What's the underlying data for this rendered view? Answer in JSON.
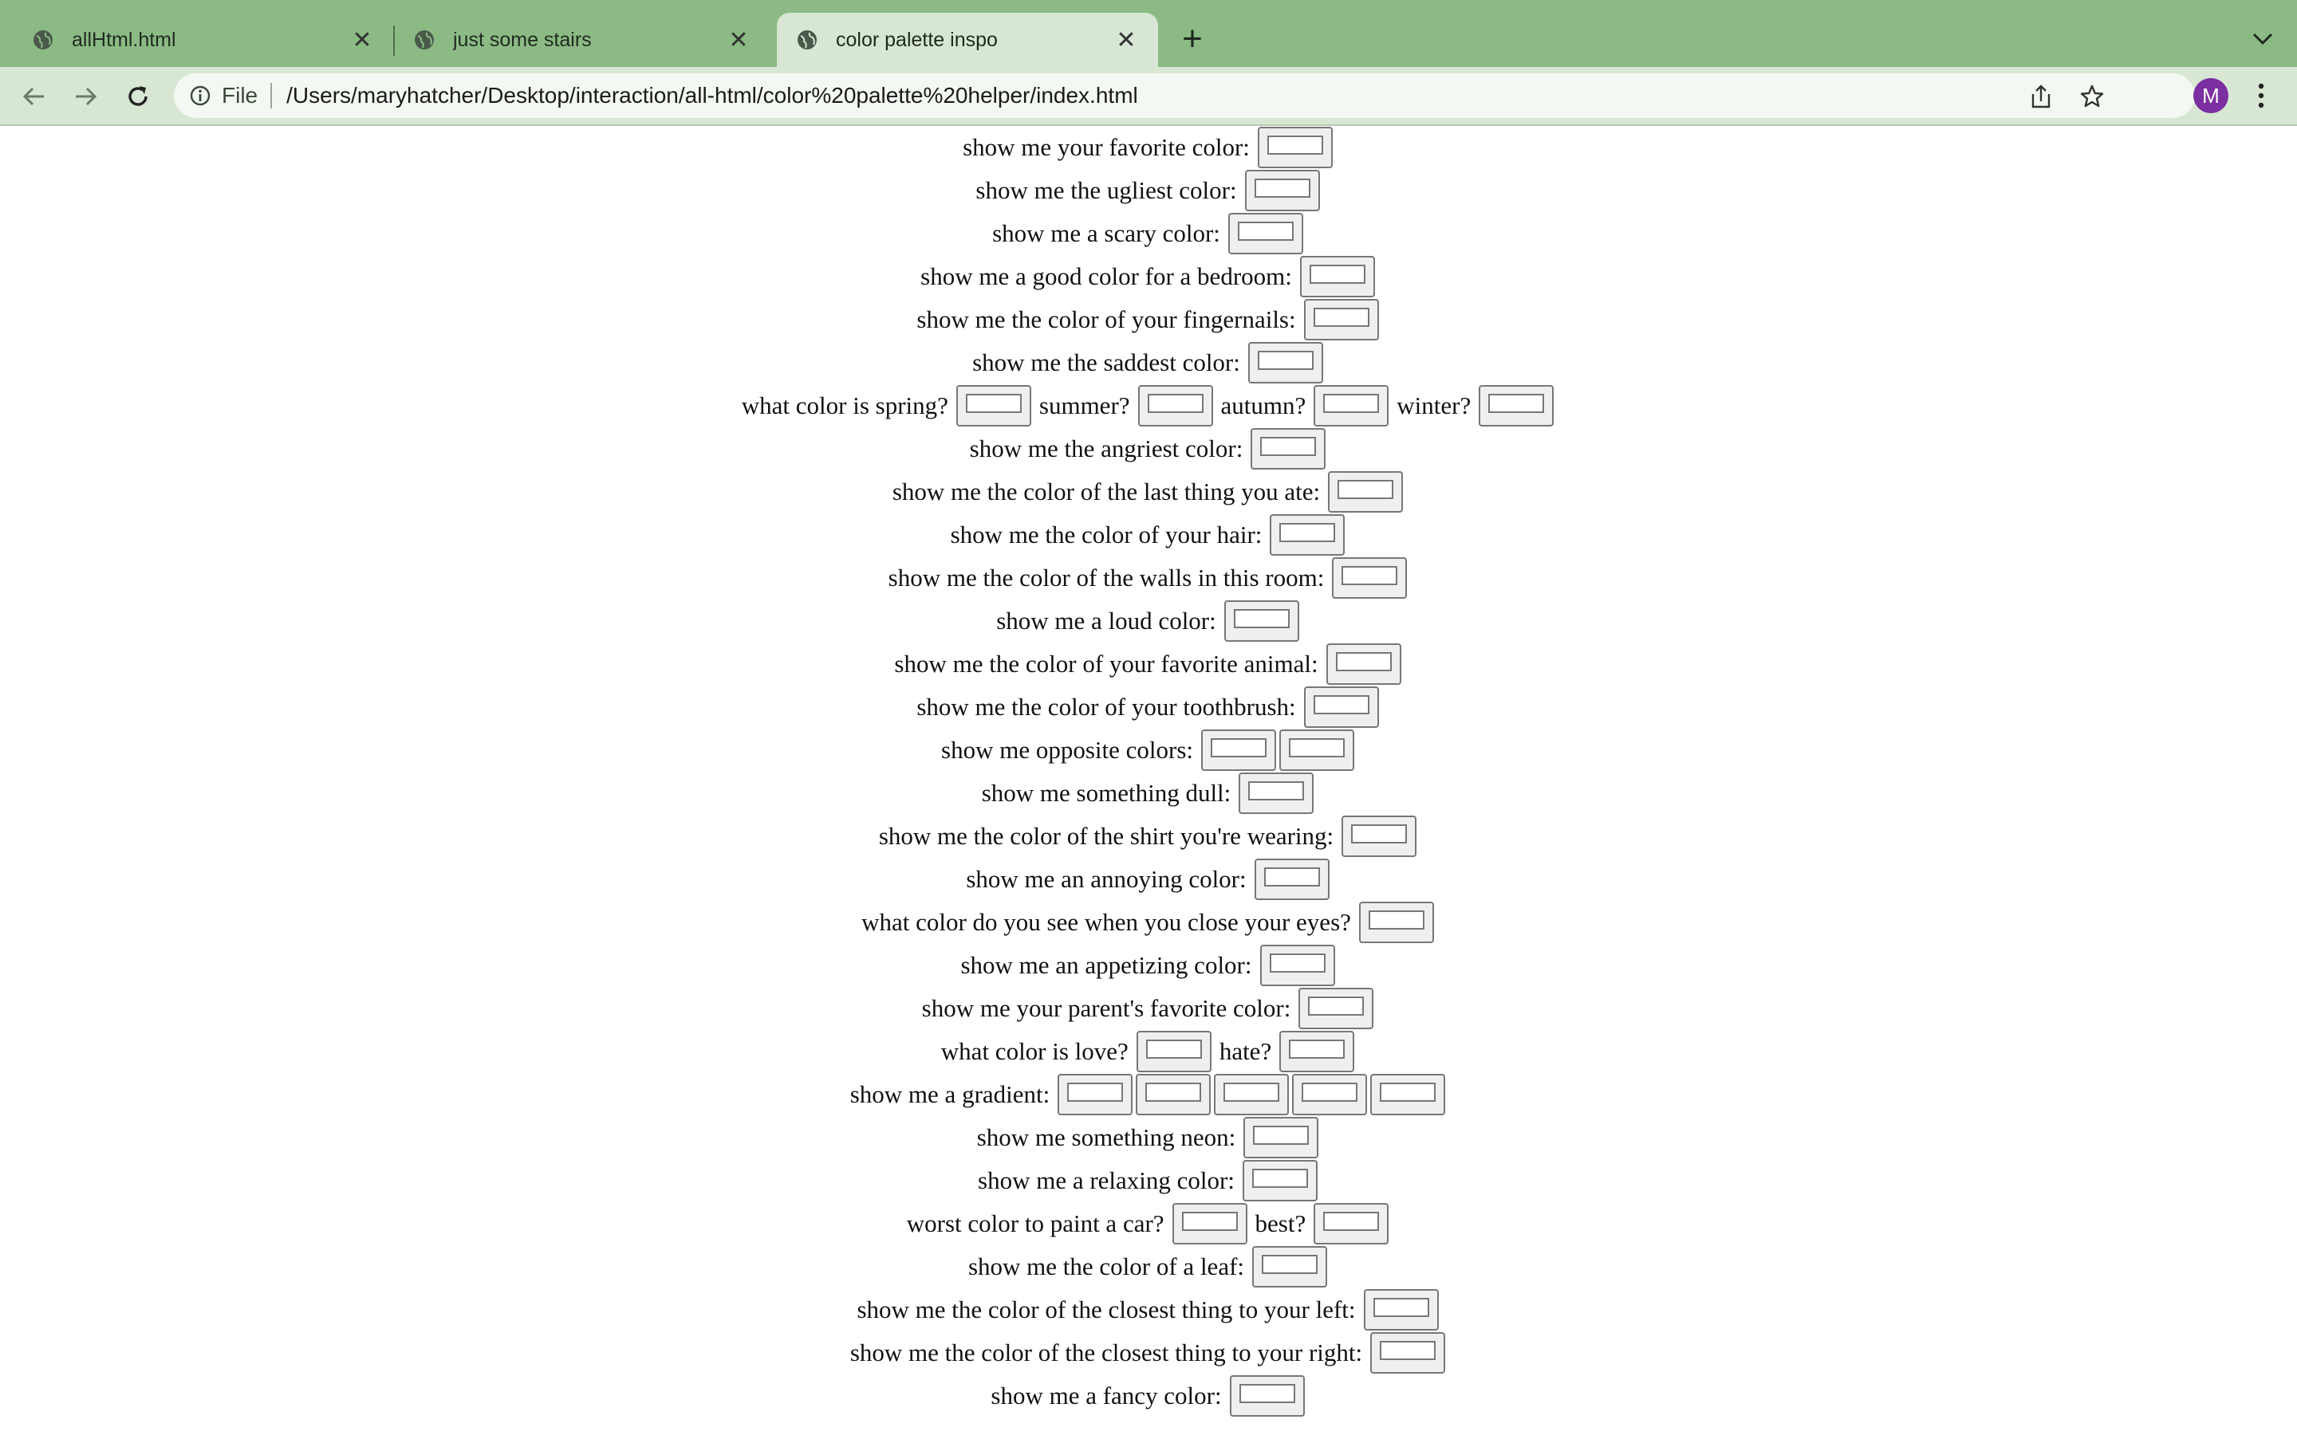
{
  "browser": {
    "tabs": [
      {
        "title": "allHtml.html",
        "active": false
      },
      {
        "title": "just some stairs",
        "active": false
      },
      {
        "title": "color palette inspo",
        "active": true
      }
    ],
    "address": {
      "scheme": "File",
      "url": "/Users/maryhatcher/Desktop/interaction/all-html/color%20palette%20helper/index.html"
    },
    "profile_initial": "M",
    "colors": {
      "tabbar": "#8cba85",
      "toolbar": "#d7e7d3",
      "avatar": "#7b2fa0"
    }
  },
  "page": {
    "rows": [
      {
        "parts": [
          {
            "label": "show me your favorite color:",
            "swatches": 1
          }
        ]
      },
      {
        "parts": [
          {
            "label": "show me the ugliest color:",
            "swatches": 1
          }
        ]
      },
      {
        "parts": [
          {
            "label": "show me a scary color:",
            "swatches": 1
          }
        ]
      },
      {
        "parts": [
          {
            "label": "show me a good color for a bedroom:",
            "swatches": 1
          }
        ]
      },
      {
        "parts": [
          {
            "label": "show me the color of your fingernails:",
            "swatches": 1
          }
        ]
      },
      {
        "parts": [
          {
            "label": "show me the saddest color:",
            "swatches": 1
          }
        ]
      },
      {
        "parts": [
          {
            "label": "what color is spring?",
            "swatches": 1
          },
          {
            "label": "summer?",
            "swatches": 1
          },
          {
            "label": "autumn?",
            "swatches": 1
          },
          {
            "label": "winter?",
            "swatches": 1
          }
        ]
      },
      {
        "parts": [
          {
            "label": "show me the angriest color:",
            "swatches": 1
          }
        ]
      },
      {
        "parts": [
          {
            "label": "show me the color of the last thing you ate:",
            "swatches": 1
          }
        ]
      },
      {
        "parts": [
          {
            "label": "show me the color of your hair:",
            "swatches": 1
          }
        ]
      },
      {
        "parts": [
          {
            "label": "show me the color of the walls in this room:",
            "swatches": 1
          }
        ]
      },
      {
        "parts": [
          {
            "label": "show me a loud color:",
            "swatches": 1
          }
        ]
      },
      {
        "parts": [
          {
            "label": "show me the color of your favorite animal:",
            "swatches": 1
          }
        ]
      },
      {
        "parts": [
          {
            "label": "show me the color of your toothbrush:",
            "swatches": 1
          }
        ]
      },
      {
        "parts": [
          {
            "label": "show me opposite colors:",
            "swatches": 2
          }
        ]
      },
      {
        "parts": [
          {
            "label": "show me something dull:",
            "swatches": 1
          }
        ]
      },
      {
        "parts": [
          {
            "label": "show me the color of the shirt you're wearing:",
            "swatches": 1
          }
        ]
      },
      {
        "parts": [
          {
            "label": "show me an annoying color:",
            "swatches": 1
          }
        ]
      },
      {
        "parts": [
          {
            "label": "what color do you see when you close your eyes?",
            "swatches": 1
          }
        ]
      },
      {
        "parts": [
          {
            "label": "show me an appetizing color:",
            "swatches": 1
          }
        ]
      },
      {
        "parts": [
          {
            "label": "show me your parent's favorite color:",
            "swatches": 1
          }
        ]
      },
      {
        "parts": [
          {
            "label": "what color is love?",
            "swatches": 1
          },
          {
            "label": "hate?",
            "swatches": 1
          }
        ]
      },
      {
        "parts": [
          {
            "label": "show me a gradient:",
            "swatches": 5
          }
        ]
      },
      {
        "parts": [
          {
            "label": "show me something neon:",
            "swatches": 1
          }
        ]
      },
      {
        "parts": [
          {
            "label": "show me a relaxing color:",
            "swatches": 1
          }
        ]
      },
      {
        "parts": [
          {
            "label": "worst color to paint a car?",
            "swatches": 1
          },
          {
            "label": "best?",
            "swatches": 1
          }
        ]
      },
      {
        "parts": [
          {
            "label": "show me the color of a leaf:",
            "swatches": 1
          }
        ]
      },
      {
        "parts": [
          {
            "label": "show me the color of the closest thing to your left:",
            "swatches": 1
          }
        ]
      },
      {
        "parts": [
          {
            "label": "show me the color of the closest thing to your right:",
            "swatches": 1
          }
        ]
      },
      {
        "parts": [
          {
            "label": "show me a fancy color:",
            "swatches": 1
          }
        ]
      }
    ]
  }
}
